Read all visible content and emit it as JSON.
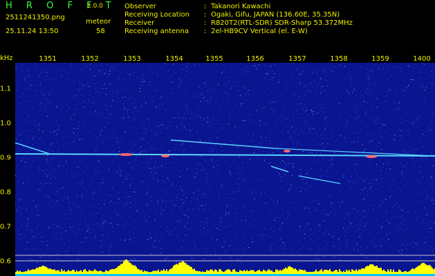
{
  "app": {
    "name": "H R O F F T",
    "version": "1.0.0",
    "filename": "2511241350.png",
    "datetime": "25.11.24 13:50",
    "meteor_label": "meteor",
    "meteor_count": "58"
  },
  "info": [
    {
      "key": "Observer",
      "value": "Takanori Kawachi"
    },
    {
      "key": "Receiving Location",
      "value": "Ogaki, Gifu, JAPAN (136.60E, 35.35N)"
    },
    {
      "key": "Receiver",
      "value": "R820T2(RTL-SDR) SDR-Sharp 53.372MHz"
    },
    {
      "key": "Receiving antenna",
      "value": "2el-HB9CV Vertical (el. E-W)"
    }
  ],
  "colon": ":",
  "axis": {
    "unit": "kHz",
    "time_ticks": [
      "1351",
      "1352",
      "1353",
      "1354",
      "1355",
      "1356",
      "1357",
      "1358",
      "1359",
      "1400"
    ],
    "freq_ticks": [
      "1.1",
      "1.0",
      "0.9",
      "0.8",
      "0.7",
      "0.6"
    ]
  },
  "colors": {
    "background": "#000000",
    "header_text": "#f0f000",
    "logo": "#38ff38",
    "spectrogram_bg": "#0a1590",
    "noise": "#2f52ff",
    "trace": "#5bd6ff",
    "hot": "#ff6a6a",
    "level_bar": "#ffff00",
    "level_base": "#00c8ff",
    "guide_line": "#c8c8c8"
  }
}
